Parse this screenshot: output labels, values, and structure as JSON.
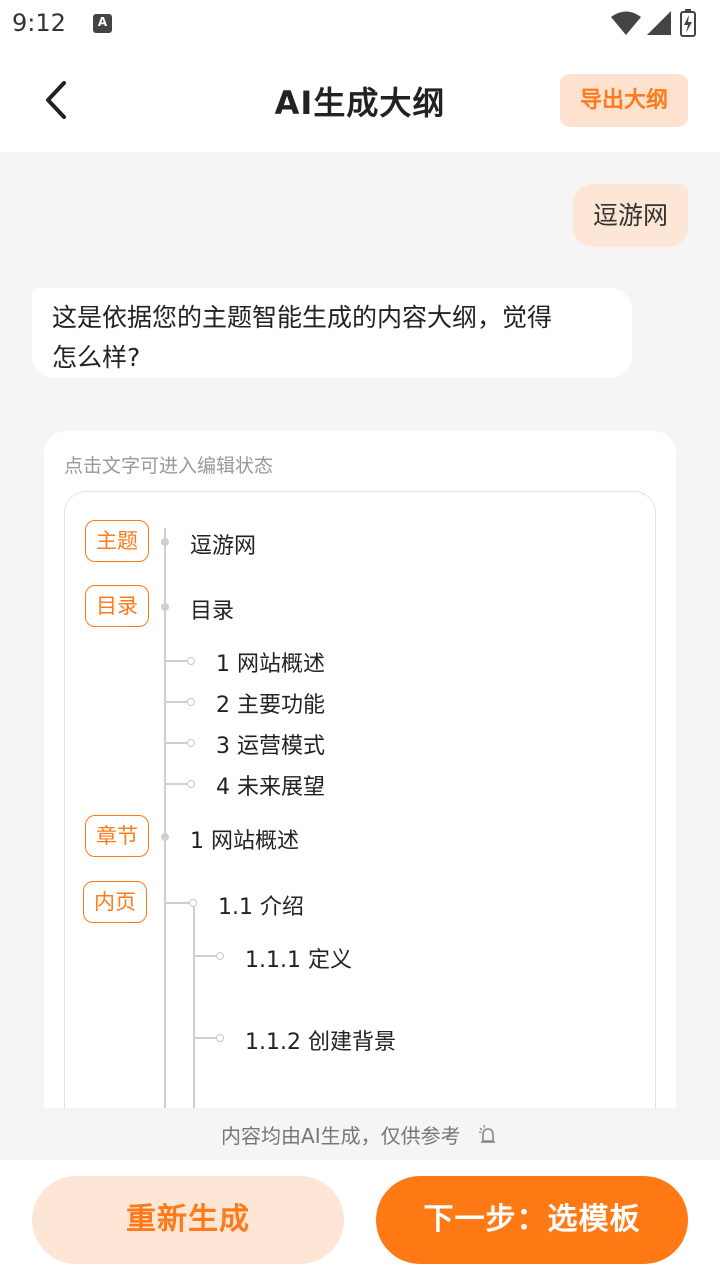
{
  "status_bar": {
    "time": "9:12",
    "notification_icon": "A",
    "icons": [
      "wifi-icon",
      "signal-icon",
      "battery-charging-icon"
    ]
  },
  "header": {
    "title": "AI生成大纲",
    "export_label": "导出大纲"
  },
  "chat": {
    "user_message": "逗游网",
    "ai_line1": "这是依据您的主题智能生成的内容大纲，觉得",
    "ai_line2": "怎么样?"
  },
  "outline": {
    "hint": "点击文字可进入编辑状态",
    "topic_tag": "主题",
    "topic": "逗游网",
    "toc_tag": "目录",
    "toc": "目录",
    "toc_items": [
      "1 网站概述",
      "2 主要功能",
      "3 运营模式",
      "4 未来展望"
    ],
    "chapter_tag": "章节",
    "chapter": "1 网站概述",
    "page_tag": "内页",
    "page": "1.1 介绍",
    "sub_items": [
      "1.1.1 定义",
      "1.1.2 创建背景"
    ]
  },
  "footer": {
    "disclaimer": "内容均由AI生成，仅供参考",
    "regen_label": "重新生成",
    "next_label": "下一步：选模板"
  },
  "colors": {
    "accent": "#ff7a14",
    "accent_light": "#fde6d6"
  }
}
